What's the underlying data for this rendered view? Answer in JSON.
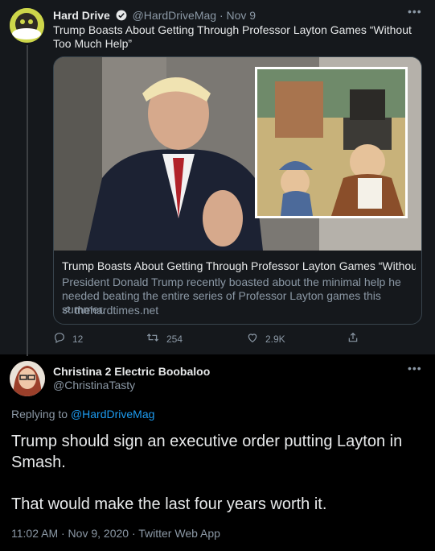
{
  "parent": {
    "name": "Hard Drive",
    "handle": "@HardDriveMag",
    "date": "· Nov 9",
    "text": "Trump Boasts About Getting Through Professor Layton Games “Without Too Much Help”",
    "more_icon": "more-icon",
    "card": {
      "title": "Trump Boasts About Getting Through Professor Layton Games “Without...",
      "description": "President Donald Trump recently boasted about the minimal help he needed beating the entire series of Professor Layton games this summer.",
      "link": "thehardtimes.net"
    },
    "actions": {
      "reply": "12",
      "retweet": "254",
      "like": "2.9K"
    }
  },
  "reply": {
    "name": "Christina 2 Electric Boobaloo",
    "handle": "@ChristinaTasty",
    "replying_prefix": "Replying to",
    "replying_handle": "@HardDriveMag",
    "text_line1": "Trump should sign an executive order putting Layton in Smash.",
    "text_line2": "That would make the last four years worth it.",
    "footer": "11:02 AM · Nov 9, 2020 · Twitter Web App"
  },
  "colors": {
    "background": "#000000",
    "parent_bg": "#15181c",
    "link": "#1d9bf0",
    "muted": "#8b98a5",
    "text": "#e7e9ea"
  }
}
